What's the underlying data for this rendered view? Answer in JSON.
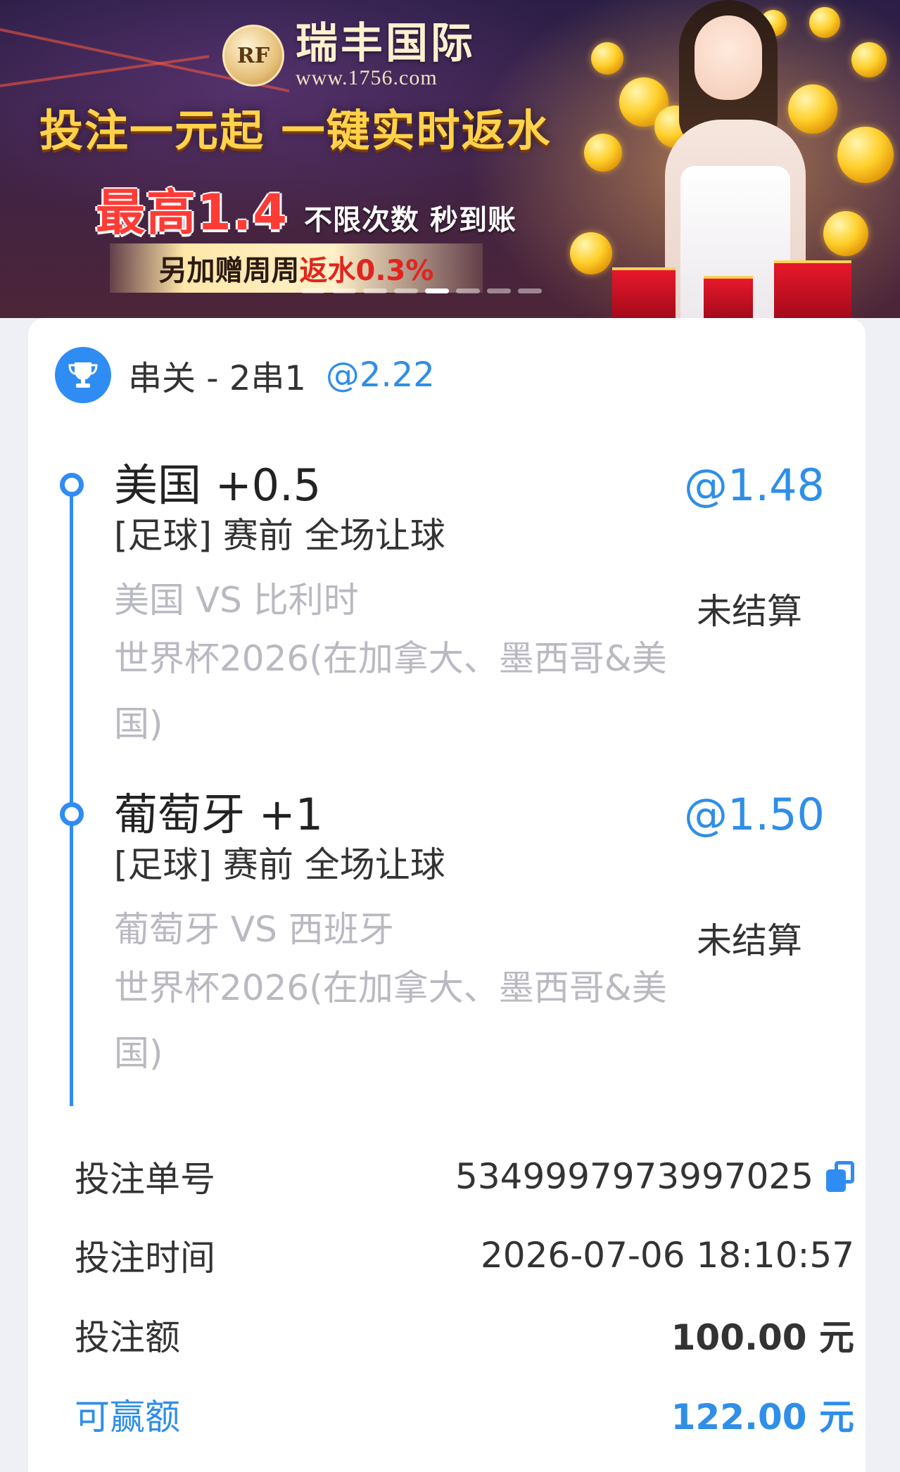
{
  "banner": {
    "logo_mark": "RF",
    "logo_name": "瑞丰国际",
    "logo_url": "www.1756.com",
    "headline": "投注一元起 一键实时返水",
    "max_rebate": "最高1.4",
    "unlimited": "不限次数 秒到账",
    "extra_prefix": "另加赠周周",
    "extra_highlight": "返水0.3%",
    "carousel_index": 4,
    "carousel_total": 8
  },
  "bet": {
    "type": "串关 - 2串1",
    "total_odds": "@2.22",
    "legs": [
      {
        "selection": "美国 +0.5",
        "odds": "@1.48",
        "market": "[足球] 赛前 全场让球",
        "match": "美国 VS 比利时",
        "league": "世界杯2026(在加拿大、墨西哥&美国)",
        "status": "未结算"
      },
      {
        "selection": "葡萄牙 +1",
        "odds": "@1.50",
        "market": "[足球] 赛前 全场让球",
        "match": "葡萄牙 VS 西班牙",
        "league": "世界杯2026(在加拿大、墨西哥&美国)",
        "status": "未结算"
      }
    ],
    "details": {
      "order_label": "投注单号",
      "order_value": "5349997973997025",
      "time_label": "投注时间",
      "time_value": "2026-07-06 18:10:57",
      "stake_label": "投注额",
      "stake_value": "100.00 元",
      "win_label": "可赢额",
      "win_value": "122.00 元"
    }
  },
  "colors": {
    "accent": "#2f8cf2",
    "muted_text": "#b9b9c2",
    "banner_gold": "#ffd24a",
    "banner_red": "#ff3b35"
  },
  "icons": {
    "header": "trophy-icon",
    "copy": "copy-icon",
    "logo": "spade-logo-icon"
  }
}
